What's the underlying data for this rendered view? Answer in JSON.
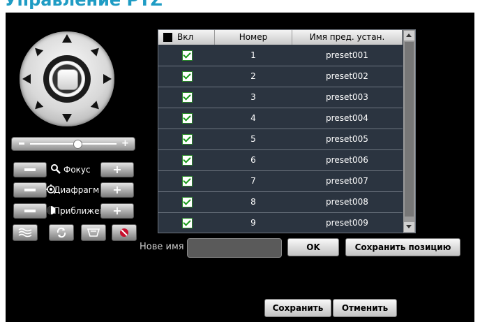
{
  "page": {
    "cutoff_heading": "Управление PTZ"
  },
  "ptz": {
    "icons": {
      "up": "arrow-up-icon",
      "down": "arrow-down-icon",
      "left": "arrow-left-icon",
      "right": "arrow-right-icon",
      "center": "stop-icon"
    },
    "speed_fraction": 0.55
  },
  "controls": {
    "focus_label": "Фокус",
    "iris_label": "Диафрагм",
    "zoom_label": "Приближен"
  },
  "tools": {
    "icons": [
      "wiper-icon",
      "rotate-icon",
      "light-icon",
      "no-light-icon"
    ]
  },
  "table": {
    "headers": [
      "Вкл",
      "Номер",
      "Имя пред. устан."
    ],
    "rows": [
      {
        "enabled": true,
        "number": "1",
        "name": "preset001"
      },
      {
        "enabled": true,
        "number": "2",
        "name": "preset002"
      },
      {
        "enabled": true,
        "number": "3",
        "name": "preset003"
      },
      {
        "enabled": true,
        "number": "4",
        "name": "preset004"
      },
      {
        "enabled": true,
        "number": "5",
        "name": "preset005"
      },
      {
        "enabled": true,
        "number": "6",
        "name": "preset006"
      },
      {
        "enabled": true,
        "number": "7",
        "name": "preset007"
      },
      {
        "enabled": true,
        "number": "8",
        "name": "preset008"
      },
      {
        "enabled": true,
        "number": "9",
        "name": "preset009"
      }
    ]
  },
  "preset_edit": {
    "new_name_label": "Нове имя",
    "new_name_value": "",
    "ok_label": "OK",
    "save_position_label": "Сохранить позицию"
  },
  "footer": {
    "save_label": "Сохранить",
    "cancel_label": "Отменить"
  },
  "colors": {
    "panel_bg": "#000000",
    "table_bg": "#2b3440",
    "checkbox_green": "#1a9a1a",
    "heading_blue": "#1f9cc4"
  }
}
